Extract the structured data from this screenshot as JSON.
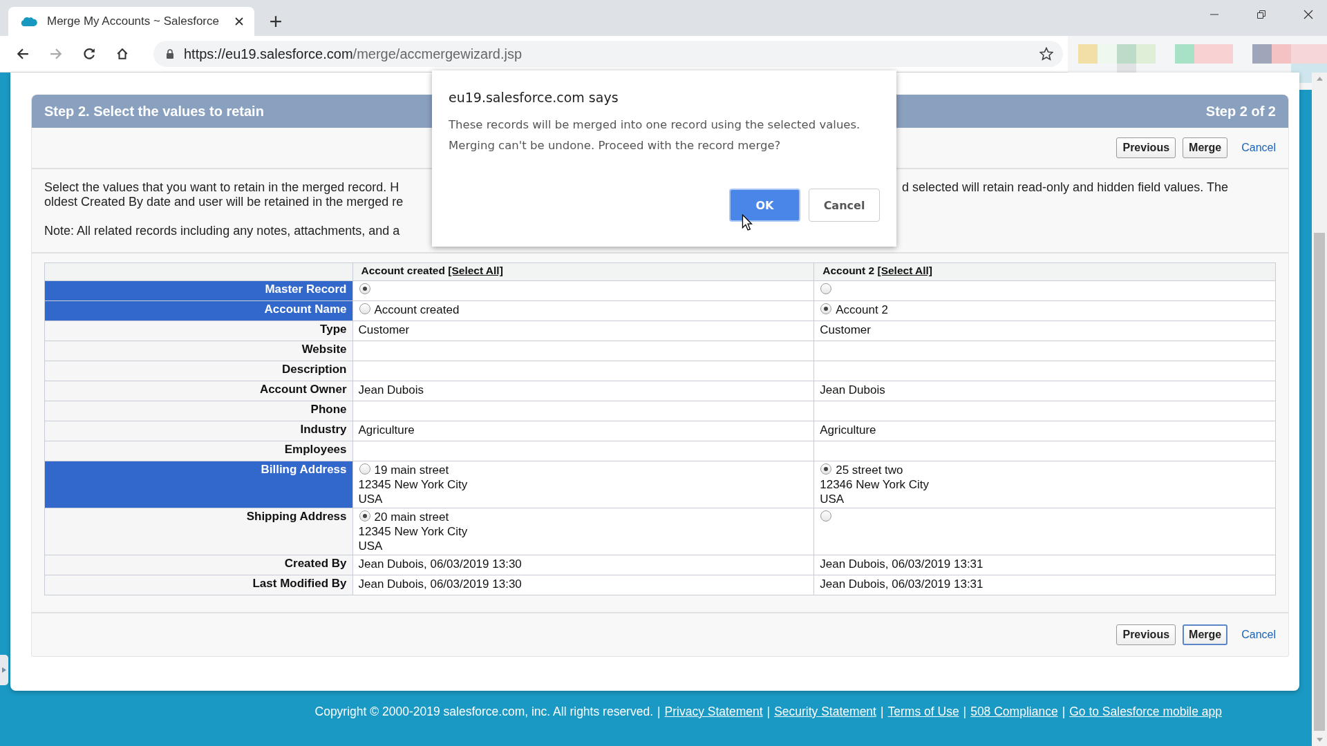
{
  "browser": {
    "tab_title": "Merge My Accounts ~ Salesforce",
    "url_host": "https://eu19.salesforce.com",
    "url_path": "/merge/accmergewizard.jsp"
  },
  "header": {
    "title": "Step 2. Select the values to retain",
    "step": "Step 2 of 2"
  },
  "top_buttons": [
    {
      "label": "Previous",
      "kind": "button",
      "focused": false
    },
    {
      "label": "Merge",
      "kind": "button",
      "focused": false
    },
    {
      "label": "Cancel",
      "kind": "link"
    }
  ],
  "description": {
    "line_1_left": "Select the values that you want to retain in the merged record. H",
    "line_1_right": "d selected will retain read-only and hidden field values. The",
    "line_2": "oldest Created By date and user will be retained in the merged re",
    "note": "Note: All related records including any notes, attachments, and a"
  },
  "table": {
    "columns": [
      {
        "name": "Account created",
        "link": "[Select All]"
      },
      {
        "name": "Account 2",
        "link": "[Select All]"
      }
    ],
    "rows": [
      {
        "label": "Master Record",
        "highlighted": true,
        "kind": "choice",
        "cells": [
          {
            "selected": true
          },
          {
            "selected": false
          }
        ]
      },
      {
        "label": "Account Name",
        "highlighted": true,
        "kind": "choice",
        "cells": [
          {
            "selected": false,
            "lines": [
              "Account created"
            ]
          },
          {
            "selected": true,
            "lines": [
              "Account 2"
            ]
          }
        ]
      },
      {
        "label": "Type",
        "highlighted": false,
        "kind": "plain",
        "cells": [
          {
            "lines": [
              "Customer"
            ]
          },
          {
            "lines": [
              "Customer"
            ]
          }
        ]
      },
      {
        "label": "Website",
        "highlighted": false,
        "kind": "plain"
      },
      {
        "label": "Description",
        "highlighted": false,
        "kind": "plain"
      },
      {
        "label": "Account Owner",
        "highlighted": false,
        "kind": "plain",
        "cells": [
          {
            "lines": [
              "Jean Dubois"
            ]
          },
          {
            "lines": [
              "Jean Dubois"
            ]
          }
        ]
      },
      {
        "label": "Phone",
        "highlighted": false,
        "kind": "plain"
      },
      {
        "label": "Industry",
        "highlighted": false,
        "kind": "plain",
        "cells": [
          {
            "lines": [
              "Agriculture"
            ]
          },
          {
            "lines": [
              "Agriculture"
            ]
          }
        ]
      },
      {
        "label": "Employees",
        "highlighted": false,
        "kind": "plain"
      },
      {
        "label": "Billing Address",
        "highlighted": true,
        "kind": "choice",
        "cells": [
          {
            "selected": false,
            "lines": [
              "19 main street",
              "12345 New York City",
              "USA"
            ]
          },
          {
            "selected": true,
            "lines": [
              "25 street two",
              "12346 New York City",
              "USA"
            ]
          }
        ]
      },
      {
        "label": "Shipping Address",
        "highlighted": false,
        "kind": "choice",
        "cells": [
          {
            "selected": true,
            "lines": [
              "20 main street",
              "12345 New York City",
              "USA"
            ]
          },
          {
            "selected": false
          }
        ]
      },
      {
        "label": "Created By",
        "highlighted": false,
        "kind": "plain",
        "cells": [
          {
            "lines": [
              "Jean Dubois, 06/03/2019 13:30"
            ]
          },
          {
            "lines": [
              "Jean Dubois, 06/03/2019 13:31"
            ]
          }
        ]
      },
      {
        "label": "Last Modified By",
        "highlighted": false,
        "kind": "plain",
        "cells": [
          {
            "lines": [
              "Jean Dubois, 06/03/2019 13:30"
            ]
          },
          {
            "lines": [
              "Jean Dubois, 06/03/2019 13:31"
            ]
          }
        ]
      }
    ]
  },
  "bottom_buttons": [
    {
      "label": "Previous",
      "kind": "button",
      "focused": false
    },
    {
      "label": "Merge",
      "kind": "button",
      "focused": true
    },
    {
      "label": "Cancel",
      "kind": "link"
    }
  ],
  "footer": {
    "items": [
      {
        "kind": "text",
        "text": "Copyright © 2000-2019 salesforce.com, inc. All rights reserved."
      },
      {
        "kind": "separator",
        "text": "|"
      },
      {
        "kind": "link",
        "text": "Privacy Statement"
      },
      {
        "kind": "separator",
        "text": "|"
      },
      {
        "kind": "link",
        "text": "Security Statement"
      },
      {
        "kind": "separator",
        "text": "|"
      },
      {
        "kind": "link",
        "text": "Terms of Use"
      },
      {
        "kind": "separator",
        "text": "|"
      },
      {
        "kind": "link",
        "text": "508 Compliance"
      },
      {
        "kind": "separator",
        "text": "|"
      },
      {
        "kind": "link",
        "text": "Go to Salesforce mobile app"
      }
    ]
  },
  "dialog": {
    "title": "eu19.salesforce.com says",
    "message": "These records will be merged into one record using the selected values. Merging can't be undone. Proceed with the record merge?",
    "buttons": [
      {
        "label": "OK",
        "primary": true
      },
      {
        "label": "Cancel",
        "primary": false
      }
    ]
  }
}
